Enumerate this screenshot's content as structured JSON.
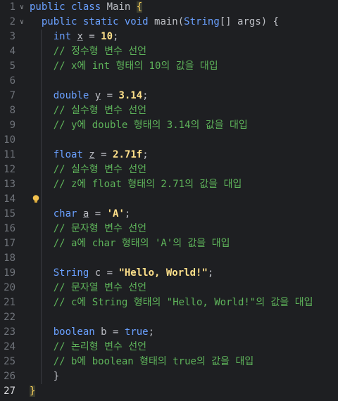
{
  "editor": {
    "lines": [
      {
        "n": "1",
        "fold": "∨",
        "segs": [
          {
            "t": "public class ",
            "c": "kwc"
          },
          {
            "t": "Main ",
            "c": "var2"
          },
          {
            "t": "{",
            "c": "brace-hl"
          }
        ]
      },
      {
        "n": "2",
        "fold": "∨",
        "segs": [
          {
            "t": "  public static void ",
            "c": "kwc"
          },
          {
            "t": "main",
            "c": "var2"
          },
          {
            "t": "(",
            "c": "punc"
          },
          {
            "t": "String",
            "c": "type"
          },
          {
            "t": "[] args) {",
            "c": "punc"
          }
        ]
      },
      {
        "n": "3",
        "segs": [
          {
            "t": "    int ",
            "c": "kwc"
          },
          {
            "t": "x",
            "c": "var"
          },
          {
            "t": " = ",
            "c": "punc"
          },
          {
            "t": "10",
            "c": "numlit"
          },
          {
            "t": ";",
            "c": "punc"
          }
        ]
      },
      {
        "n": "4",
        "segs": [
          {
            "t": "    // 정수형 변수 선언",
            "c": "cmt"
          }
        ]
      },
      {
        "n": "5",
        "segs": [
          {
            "t": "    // x에 int 형태의 10의 값을 대입",
            "c": "cmt"
          }
        ]
      },
      {
        "n": "6",
        "segs": []
      },
      {
        "n": "7",
        "segs": [
          {
            "t": "    double ",
            "c": "kwc"
          },
          {
            "t": "y",
            "c": "var"
          },
          {
            "t": " = ",
            "c": "punc"
          },
          {
            "t": "3.14",
            "c": "numlit"
          },
          {
            "t": ";",
            "c": "punc"
          }
        ]
      },
      {
        "n": "8",
        "segs": [
          {
            "t": "    // 실수형 변수 선언",
            "c": "cmt"
          }
        ]
      },
      {
        "n": "9",
        "segs": [
          {
            "t": "    // y에 double 형태의 3.14의 값을 대입",
            "c": "cmt"
          }
        ]
      },
      {
        "n": "10",
        "segs": []
      },
      {
        "n": "11",
        "segs": [
          {
            "t": "    float ",
            "c": "kwc"
          },
          {
            "t": "z",
            "c": "var"
          },
          {
            "t": " = ",
            "c": "punc"
          },
          {
            "t": "2.71f",
            "c": "numlit"
          },
          {
            "t": ";",
            "c": "punc"
          }
        ]
      },
      {
        "n": "12",
        "segs": [
          {
            "t": "    // 실수형 변수 선언",
            "c": "cmt"
          }
        ]
      },
      {
        "n": "13",
        "segs": [
          {
            "t": "    // z에 float 형태의 2.71의 값을 대입",
            "c": "cmt"
          }
        ]
      },
      {
        "n": "14",
        "bulb": true,
        "segs": []
      },
      {
        "n": "15",
        "segs": [
          {
            "t": "    char ",
            "c": "kwc"
          },
          {
            "t": "a",
            "c": "var"
          },
          {
            "t": " = ",
            "c": "punc"
          },
          {
            "t": "'A'",
            "c": "chr"
          },
          {
            "t": ";",
            "c": "punc"
          }
        ]
      },
      {
        "n": "16",
        "segs": [
          {
            "t": "    // 문자형 변수 선언",
            "c": "cmt"
          }
        ]
      },
      {
        "n": "17",
        "segs": [
          {
            "t": "    // a에 char 형태의 'A'의 값을 대입",
            "c": "cmt"
          }
        ]
      },
      {
        "n": "18",
        "segs": []
      },
      {
        "n": "19",
        "segs": [
          {
            "t": "    String ",
            "c": "kwc"
          },
          {
            "t": "c",
            "c": "var2"
          },
          {
            "t": " = ",
            "c": "punc"
          },
          {
            "t": "\"Hello, World!\"",
            "c": "str"
          },
          {
            "t": ";",
            "c": "punc"
          }
        ]
      },
      {
        "n": "20",
        "segs": [
          {
            "t": "    // 문자열 변수 선언",
            "c": "cmt"
          }
        ]
      },
      {
        "n": "21",
        "segs": [
          {
            "t": "    // c에 String 형태의 \"Hello, World!\"의 값을 대입",
            "c": "cmt"
          }
        ]
      },
      {
        "n": "22",
        "segs": []
      },
      {
        "n": "23",
        "segs": [
          {
            "t": "    boolean ",
            "c": "kwc"
          },
          {
            "t": "b",
            "c": "var2"
          },
          {
            "t": " = ",
            "c": "punc"
          },
          {
            "t": "true",
            "c": "kwc"
          },
          {
            "t": ";",
            "c": "punc"
          }
        ]
      },
      {
        "n": "24",
        "segs": [
          {
            "t": "    // 논리형 변수 선언",
            "c": "cmt"
          }
        ]
      },
      {
        "n": "25",
        "segs": [
          {
            "t": "    // b에 boolean 형태의 true의 값을 대입",
            "c": "cmt"
          }
        ]
      },
      {
        "n": "26",
        "segs": [
          {
            "t": "    }",
            "c": "punc"
          }
        ]
      },
      {
        "n": "27",
        "current": true,
        "segs": [
          {
            "t": "}",
            "c": "brace-hl"
          }
        ]
      }
    ],
    "colors": {
      "background": "#1e1f22",
      "keyword": "#6aa0ff",
      "comment": "#5eb35a",
      "literal": "#ffe08a",
      "line_number": "#6f737a"
    },
    "icons": {
      "fold": "chevron-down-icon",
      "intention": "lightbulb-icon"
    }
  }
}
